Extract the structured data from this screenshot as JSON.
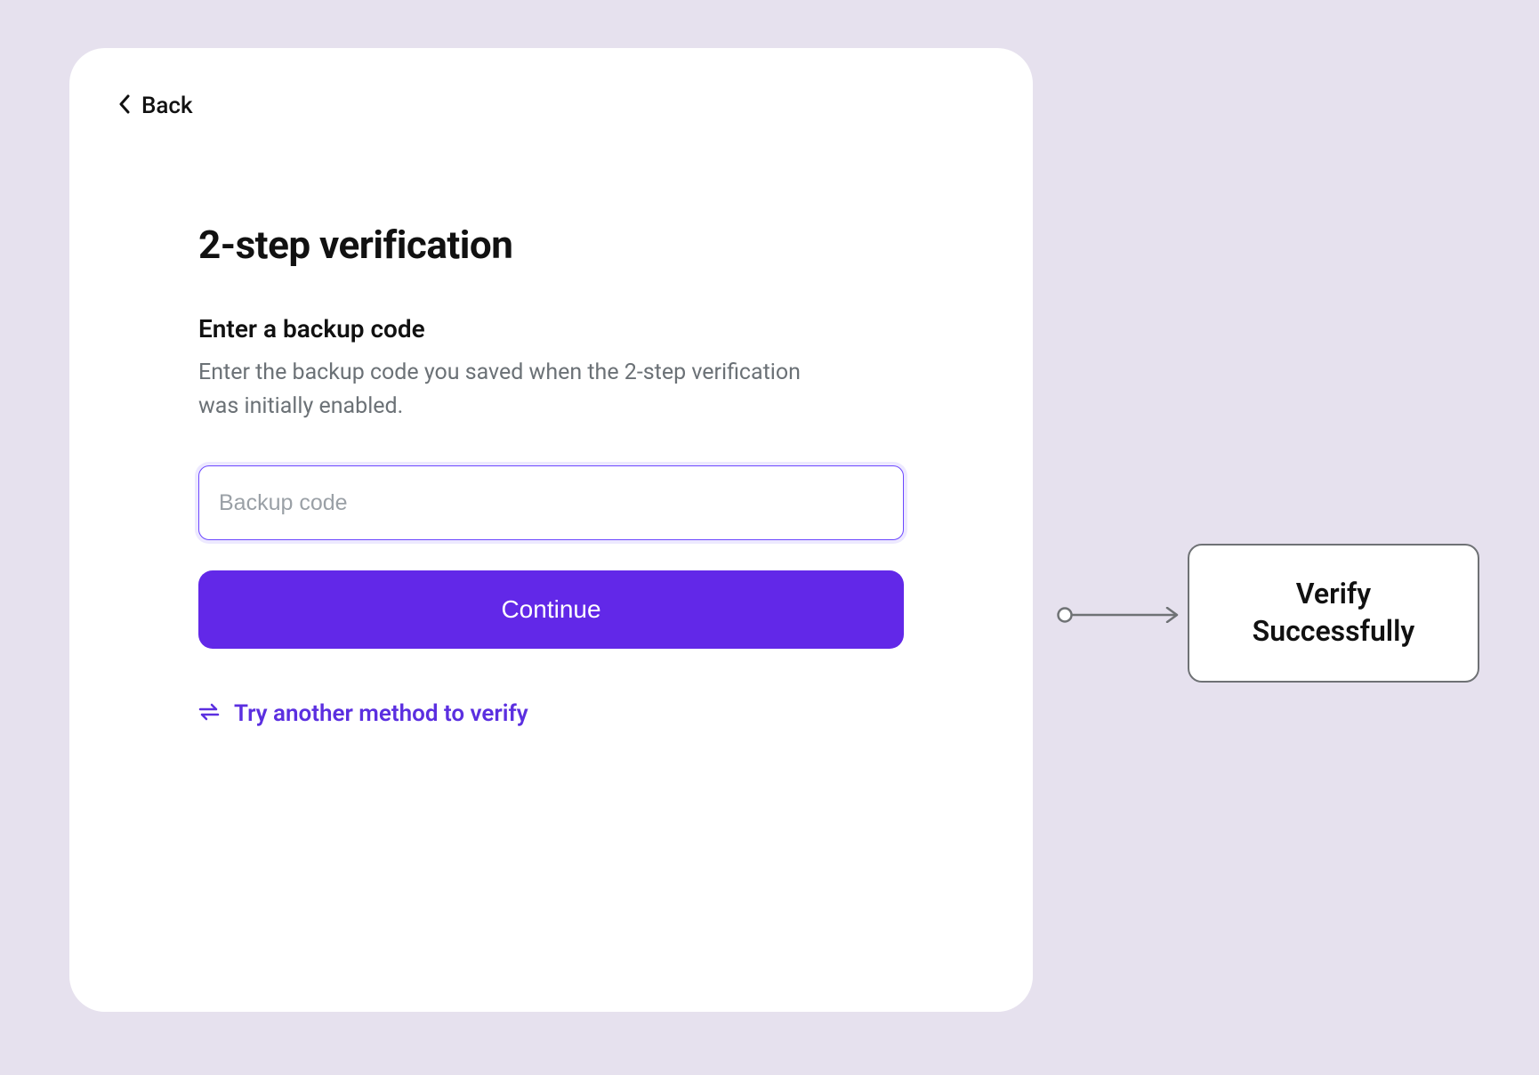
{
  "back": {
    "label": "Back"
  },
  "page": {
    "title": "2-step verification",
    "subtitle": "Enter a backup code",
    "description": "Enter the backup code you saved when the 2-step verification was initially enabled."
  },
  "input": {
    "placeholder": "Backup code",
    "value": ""
  },
  "continue": {
    "label": "Continue"
  },
  "alt_method": {
    "label": "Try another method to verify"
  },
  "success": {
    "text": "Verify\nSuccessfully"
  },
  "colors": {
    "accent": "#6228e8",
    "input_border": "#6c47ff",
    "background": "#e6e1ee"
  }
}
